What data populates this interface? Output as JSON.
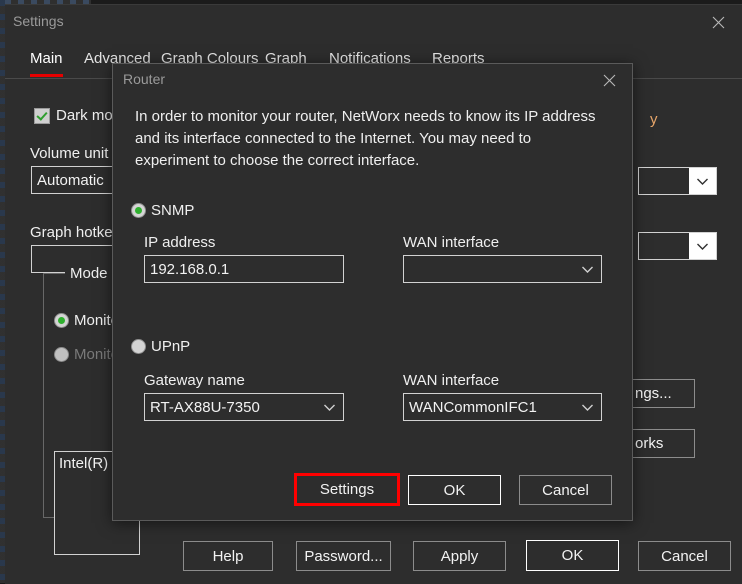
{
  "settings_window": {
    "title": "Settings",
    "close_icon": "close-icon",
    "tabs": [
      {
        "label": "Main",
        "selected": true
      },
      {
        "label": "Advanced",
        "selected": false
      },
      {
        "label": "Graph Colours",
        "selected": false
      },
      {
        "label": "Graph",
        "selected": false
      },
      {
        "label": "Notifications",
        "selected": false
      },
      {
        "label": "Reports",
        "selected": false
      }
    ],
    "dark_mode": {
      "label": "Dark mod",
      "checked": true
    },
    "volume_unit": {
      "label": "Volume unit",
      "value": "Automatic"
    },
    "graph_hotkey": {
      "label": "Graph hotke",
      "value": ""
    },
    "mode_group": {
      "title": "Mode",
      "options": [
        {
          "label": "Monito",
          "checked": true,
          "disabled": false
        },
        {
          "label": "Monito",
          "checked": false,
          "disabled": true
        }
      ],
      "adapter_list_first_item": "Intel(R) W"
    },
    "right_combo_1": {
      "value": ""
    },
    "right_combo_2": {
      "value": ""
    },
    "right_buttons": [
      {
        "label": "ngs..."
      },
      {
        "label": "orks"
      }
    ],
    "right_partial_text": "y",
    "footer_buttons": [
      {
        "label": "Help",
        "default": false
      },
      {
        "label": "Password...",
        "default": false
      },
      {
        "label": "Apply",
        "default": false
      },
      {
        "label": "OK",
        "default": true
      },
      {
        "label": "Cancel",
        "default": false
      }
    ]
  },
  "router_dialog": {
    "title": "Router",
    "close_icon": "close-icon",
    "description": "In order to monitor your router, NetWorx needs to know its IP address and its interface connected to the Internet. You may need to experiment to choose the correct interface.",
    "snmp": {
      "label": "SNMP",
      "selected": true,
      "ip_address": {
        "label": "IP address",
        "value": "192.168.0.1"
      },
      "wan_interface": {
        "label": "WAN interface",
        "value": ""
      }
    },
    "upnp": {
      "label": "UPnP",
      "selected": false,
      "gateway_name": {
        "label": "Gateway name",
        "value": "RT-AX88U-7350"
      },
      "wan_interface": {
        "label": "WAN interface",
        "value": "WANCommonIFC1"
      }
    },
    "buttons": [
      {
        "label": "Settings",
        "highlighted": true,
        "default": false
      },
      {
        "label": "OK",
        "highlighted": false,
        "default": true
      },
      {
        "label": "Cancel",
        "highlighted": false,
        "default": false
      }
    ]
  },
  "colors": {
    "window_bg": "#2d2d2d",
    "text": "#efefef",
    "accent_red": "#e60000",
    "highlight_red": "#ff0000",
    "radio_green": "#2fb02f",
    "check_green": "#2f9e2f",
    "border": "#d2d2d2"
  }
}
